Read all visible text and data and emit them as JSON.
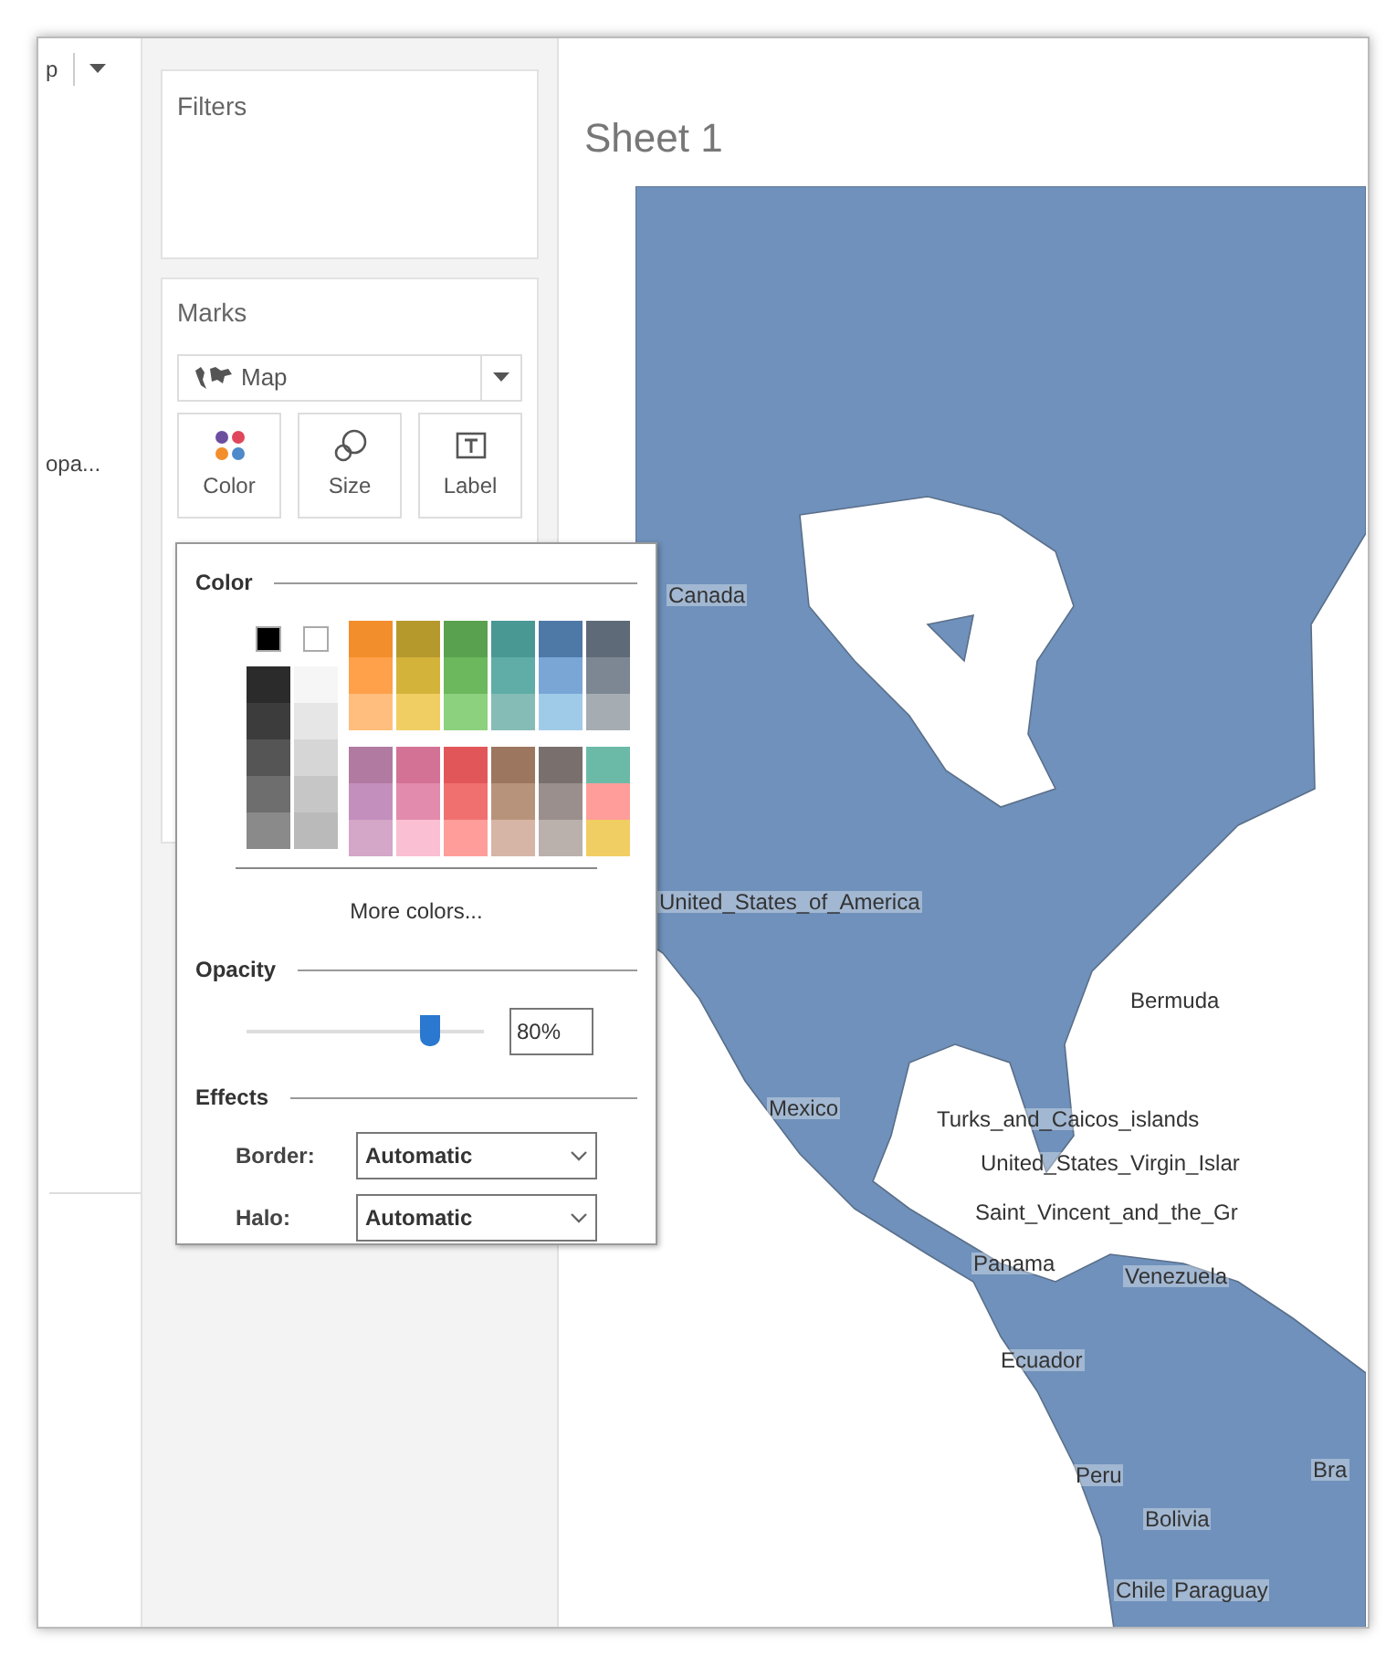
{
  "left_strip": {
    "top_label": "p",
    "field_label": "opa..."
  },
  "filters": {
    "title": "Filters"
  },
  "marks": {
    "title": "Marks",
    "mark_type": "Map",
    "buttons": [
      {
        "kind": "color",
        "label": "Color"
      },
      {
        "kind": "size",
        "label": "Size"
      },
      {
        "kind": "label",
        "label": "Label"
      }
    ]
  },
  "sheet": {
    "title": "Sheet 1"
  },
  "map": {
    "labels": [
      "Canada",
      "United_States_of_America",
      "Bermuda",
      "Mexico",
      "Turks_and_Caicos_islands",
      "United_States_Virgin_Islar",
      "Saint_Vincent_and_the_Gr",
      "Panama",
      "Venezuela",
      "Ecuador",
      "Peru",
      "Bolivia",
      "Chile",
      "Paraguay",
      "Bra"
    ]
  },
  "color_popup": {
    "title": "Color",
    "gray_columns": [
      [
        {
          "color": "#000000"
        }
      ],
      [
        {
          "color": "#2b2b2b"
        },
        {
          "color": "#3c3c3c"
        },
        {
          "color": "#555555"
        },
        {
          "color": "#6e6e6e"
        },
        {
          "color": "#8a8a8a"
        }
      ],
      [
        {
          "color": "#ffffff"
        }
      ],
      [
        {
          "color": "#f6f6f6"
        },
        {
          "color": "#e6e6e6"
        },
        {
          "color": "#d6d6d6"
        },
        {
          "color": "#c6c6c6"
        },
        {
          "color": "#bababa"
        }
      ]
    ],
    "top_block": [
      [
        {
          "color": "#f28e2b"
        },
        {
          "color": "#ffa04a"
        },
        {
          "color": "#ffbe7d"
        }
      ],
      [
        {
          "color": "#b6992d"
        },
        {
          "color": "#d4b33a"
        },
        {
          "color": "#f1ce63"
        }
      ],
      [
        {
          "color": "#59a14f"
        },
        {
          "color": "#6bb85d"
        },
        {
          "color": "#8cd17d"
        }
      ],
      [
        {
          "color": "#499894"
        },
        {
          "color": "#5fada6"
        },
        {
          "color": "#86bcb6"
        }
      ],
      [
        {
          "color": "#4e79a7"
        },
        {
          "color": "#7aa6d6"
        },
        {
          "color": "#a0cbe8"
        }
      ],
      [
        {
          "color": "#5e6a78"
        },
        {
          "color": "#7d8793"
        },
        {
          "color": "#a5acb2"
        }
      ]
    ],
    "bottom_block": [
      [
        {
          "color": "#b07aa1"
        },
        {
          "color": "#c38fbd"
        },
        {
          "color": "#d4a6c8"
        }
      ],
      [
        {
          "color": "#d37295"
        },
        {
          "color": "#e38bad"
        },
        {
          "color": "#fabfd2"
        }
      ],
      [
        {
          "color": "#e15759"
        },
        {
          "color": "#f07070"
        },
        {
          "color": "#ff9d9a"
        }
      ],
      [
        {
          "color": "#9d7660"
        },
        {
          "color": "#b8937c"
        },
        {
          "color": "#d7b5a6"
        }
      ],
      [
        {
          "color": "#79706e"
        },
        {
          "color": "#9a8f8c"
        },
        {
          "color": "#bab0ac"
        }
      ],
      [
        {
          "color": "#6bbaa8"
        },
        {
          "color": "#ff9d9a"
        },
        {
          "color": "#f1ce63"
        }
      ]
    ],
    "more_colors": "More colors...",
    "opacity_title": "Opacity",
    "opacity": {
      "level": 0.77,
      "reading": "80%"
    },
    "effects_title": "Effects",
    "effects": [
      {
        "label": "Border:",
        "value": "Automatic"
      },
      {
        "label": "Halo:",
        "value": "Automatic"
      }
    ]
  }
}
